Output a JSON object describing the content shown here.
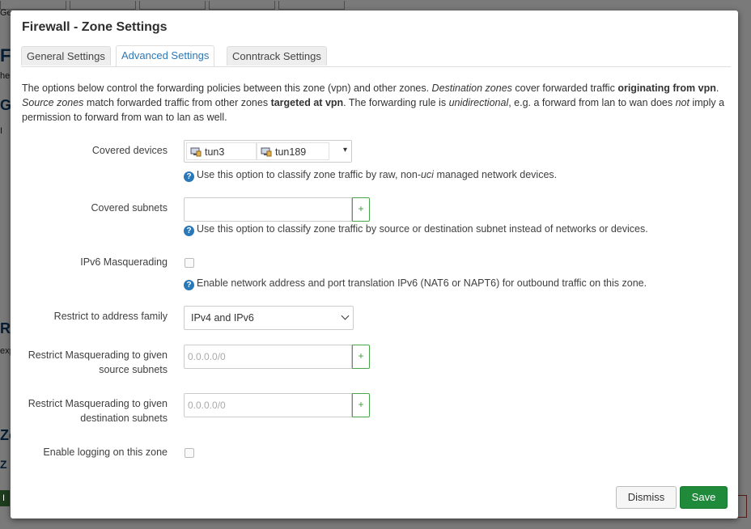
{
  "background": {
    "fragments": [
      "Ge",
      "Fi",
      "he",
      "Ge",
      "I",
      "Ro",
      "exp",
      "Zo",
      "Z",
      "I"
    ]
  },
  "modal": {
    "title": "Firewall - Zone Settings",
    "tabs": [
      {
        "label": "General Settings",
        "active": false
      },
      {
        "label": "Advanced Settings",
        "active": true
      },
      {
        "label": "Conntrack Settings",
        "active": false
      }
    ],
    "description": {
      "p1": "The options below control the forwarding policies between this zone (vpn) and other zones. ",
      "p2": "Destination zones",
      "p3": " cover forwarded traffic ",
      "p4": "originating from vpn",
      "p5": ". ",
      "p6": "Source zones",
      "p7": " match forwarded traffic from other zones ",
      "p8": "targeted at vpn",
      "p9": ". The forwarding rule is ",
      "p10": "unidirectional",
      "p11": ", e.g. a forward from lan to wan does ",
      "p12": "not",
      "p13": " imply a permission to forward from wan to lan as well."
    },
    "covered_devices": {
      "label": "Covered devices",
      "devices": [
        "tun3",
        "tun189"
      ],
      "hint_a": "Use this option to classify zone traffic by raw, non-",
      "hint_b": "uci",
      "hint_c": " managed network devices."
    },
    "covered_subnets": {
      "label": "Covered subnets",
      "value": "",
      "add": "+",
      "hint": "Use this option to classify zone traffic by source or destination subnet instead of networks or devices."
    },
    "ipv6_masq": {
      "label": "IPv6 Masquerading",
      "checked": false,
      "hint": "Enable network address and port translation IPv6 (NAT6 or NAPT6) for outbound traffic on this zone."
    },
    "address_family": {
      "label": "Restrict to address family",
      "selected": "IPv4 and IPv6"
    },
    "masq_src": {
      "label_line1": "Restrict Masquerading to given",
      "label_line2": "source subnets",
      "placeholder": "0.0.0.0/0",
      "add": "+"
    },
    "masq_dest": {
      "label_line1": "Restrict Masquerading to given",
      "label_line2": "destination subnets",
      "placeholder": "0.0.0.0/0",
      "add": "+"
    },
    "logging": {
      "label": "Enable logging on this zone",
      "checked": false
    },
    "buttons": {
      "dismiss": "Dismiss",
      "save": "Save"
    },
    "colors": {
      "accent": "#2b78b8",
      "save": "#1f8a3a",
      "add_border": "#4aa64a"
    },
    "help_glyph": "?",
    "caret_glyph": "▾"
  }
}
